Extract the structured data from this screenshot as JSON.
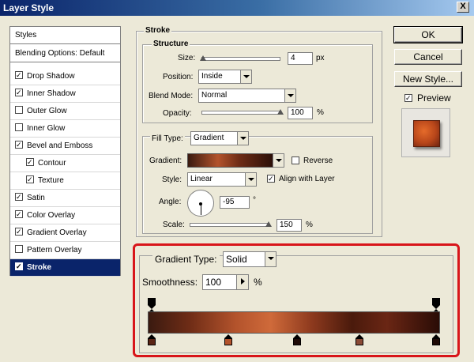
{
  "window": {
    "title": "Layer Style",
    "close_glyph": "X"
  },
  "styles_panel": {
    "header": "Styles",
    "items": [
      {
        "label": "Blending Options: Default",
        "has_checkbox": false,
        "checked": false,
        "indent": false,
        "selected": false
      },
      {
        "label": "Drop Shadow",
        "has_checkbox": true,
        "checked": true,
        "indent": false,
        "selected": false
      },
      {
        "label": "Inner Shadow",
        "has_checkbox": true,
        "checked": true,
        "indent": false,
        "selected": false
      },
      {
        "label": "Outer Glow",
        "has_checkbox": true,
        "checked": false,
        "indent": false,
        "selected": false
      },
      {
        "label": "Inner Glow",
        "has_checkbox": true,
        "checked": false,
        "indent": false,
        "selected": false
      },
      {
        "label": "Bevel and Emboss",
        "has_checkbox": true,
        "checked": true,
        "indent": false,
        "selected": false
      },
      {
        "label": "Contour",
        "has_checkbox": true,
        "checked": true,
        "indent": true,
        "selected": false
      },
      {
        "label": "Texture",
        "has_checkbox": true,
        "checked": true,
        "indent": true,
        "selected": false
      },
      {
        "label": "Satin",
        "has_checkbox": true,
        "checked": true,
        "indent": false,
        "selected": false
      },
      {
        "label": "Color Overlay",
        "has_checkbox": true,
        "checked": true,
        "indent": false,
        "selected": false
      },
      {
        "label": "Gradient Overlay",
        "has_checkbox": true,
        "checked": true,
        "indent": false,
        "selected": false
      },
      {
        "label": "Pattern Overlay",
        "has_checkbox": true,
        "checked": false,
        "indent": false,
        "selected": false
      },
      {
        "label": "Stroke",
        "has_checkbox": true,
        "checked": true,
        "indent": false,
        "selected": true
      }
    ]
  },
  "stroke": {
    "title": "Stroke",
    "structure": {
      "title": "Structure",
      "size_label": "Size:",
      "size_value": "4",
      "size_unit": "px",
      "size_level": 0.02,
      "position_label": "Position:",
      "position_value": "Inside",
      "blend_label": "Blend Mode:",
      "blend_value": "Normal",
      "opacity_label": "Opacity:",
      "opacity_value": "100",
      "opacity_unit": "%",
      "opacity_level": 1.0
    },
    "fill": {
      "fill_type_label": "Fill Type:",
      "fill_type_value": "Gradient",
      "gradient_label": "Gradient:",
      "reverse_label": "Reverse",
      "reverse_checked": false,
      "style_label": "Style:",
      "style_value": "Linear",
      "align_label": "Align with Layer",
      "align_checked": true,
      "angle_label": "Angle:",
      "angle_value": "-95",
      "angle_unit": "°",
      "scale_label": "Scale:",
      "scale_value": "150",
      "scale_unit": "%",
      "scale_level": 1.0
    }
  },
  "buttons": {
    "ok": "OK",
    "cancel": "Cancel",
    "new_style": "New Style...",
    "preview_label": "Preview",
    "preview_checked": true
  },
  "gradient_editor": {
    "type_label": "Gradient Type:",
    "type_value": "Solid",
    "smoothness_label": "Smoothness:",
    "smoothness_value": "100",
    "smoothness_unit": "%",
    "opacity_stops": [
      0.0,
      1.0
    ],
    "color_stops": [
      {
        "position": 0.0,
        "color": "#5a2414"
      },
      {
        "position": 0.27,
        "color": "#b3532c"
      },
      {
        "position": 0.51,
        "color": "#1e0a06"
      },
      {
        "position": 0.73,
        "color": "#8a4a36"
      },
      {
        "position": 1.0,
        "color": "#1e0a06"
      }
    ]
  },
  "colors": {
    "selection": "#0a246a",
    "highlight_border": "#d8151a",
    "dialog_bg": "#ece9d8"
  }
}
